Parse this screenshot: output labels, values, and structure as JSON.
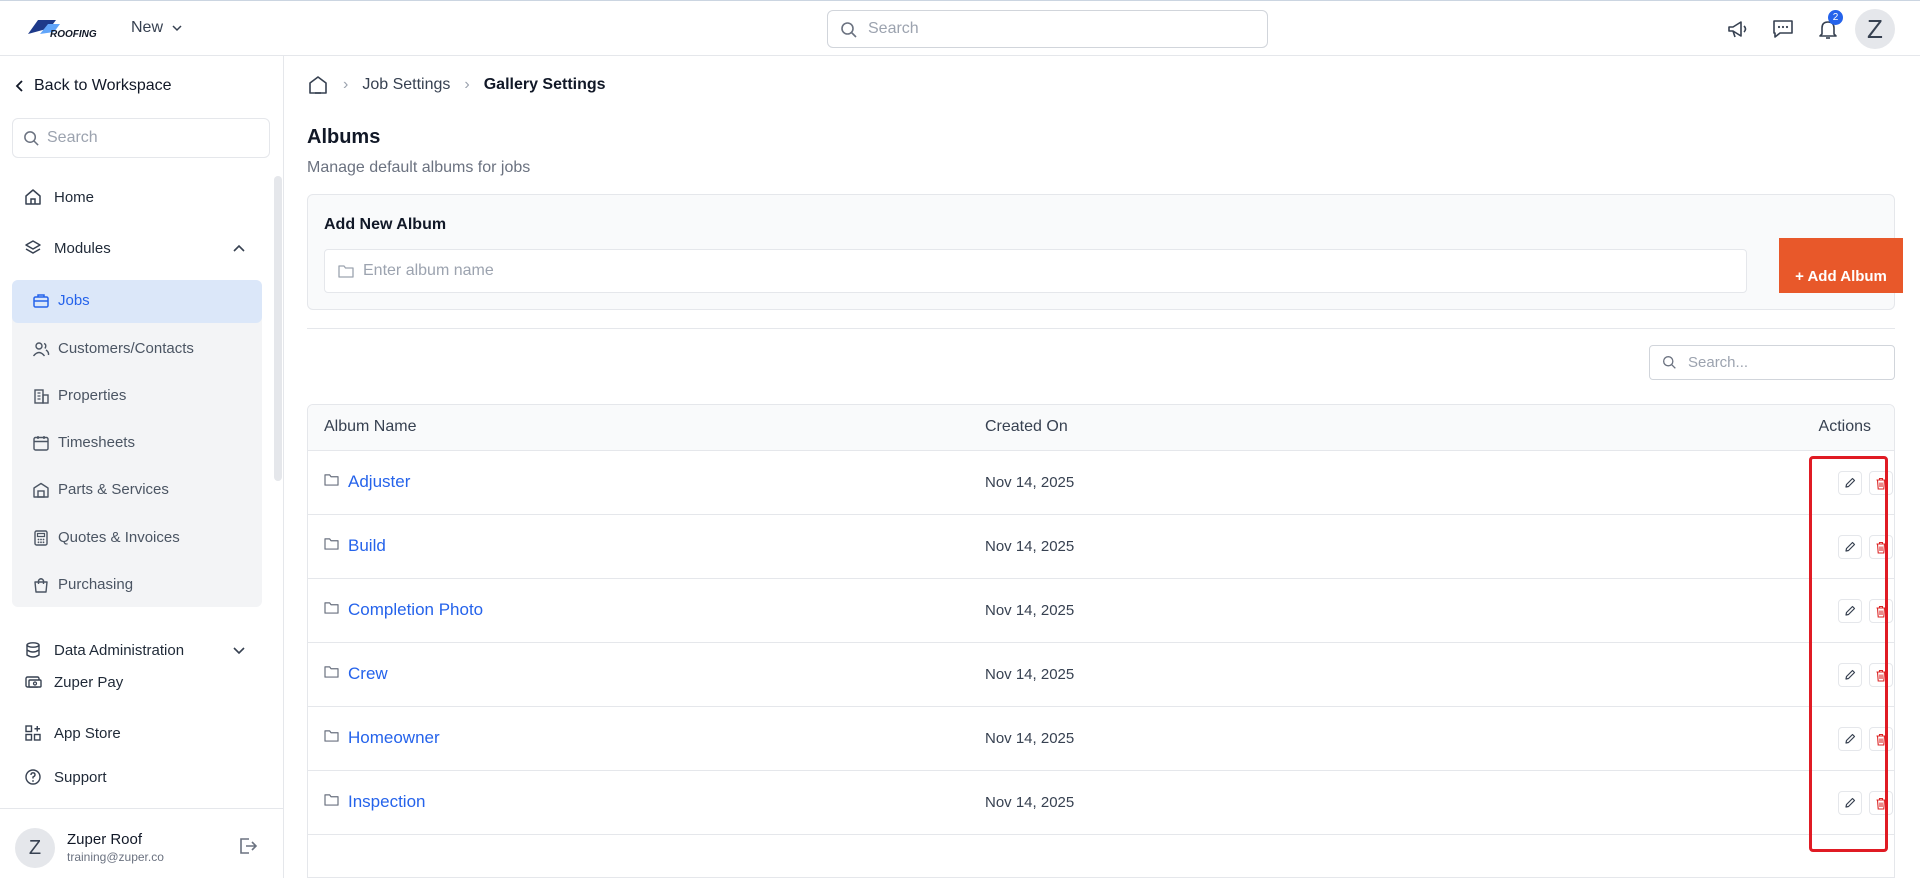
{
  "topbar": {
    "logo_text": "ROOFING",
    "new_label": "New",
    "search_placeholder": "Search",
    "notification_count": "2",
    "avatar_letter": "Z"
  },
  "sidebar": {
    "back_label": "Back to Workspace",
    "search_placeholder": "Search",
    "home_label": "Home",
    "modules_label": "Modules",
    "module_items": [
      {
        "label": "Jobs",
        "icon": "briefcase-icon",
        "active": true
      },
      {
        "label": "Customers/Contacts",
        "icon": "users-icon"
      },
      {
        "label": "Properties",
        "icon": "building-icon"
      },
      {
        "label": "Timesheets",
        "icon": "calendar-icon"
      },
      {
        "label": "Parts & Services",
        "icon": "warehouse-icon"
      },
      {
        "label": "Quotes & Invoices",
        "icon": "calculator-icon"
      },
      {
        "label": "Purchasing",
        "icon": "shopping-bag-icon"
      }
    ],
    "data_admin_label": "Data Administration",
    "zuper_pay_label": "Zuper Pay",
    "app_store_label": "App Store",
    "support_label": "Support",
    "user": {
      "initial": "Z",
      "name": "Zuper Roof",
      "email": "training@zuper.co"
    }
  },
  "main": {
    "breadcrumb": [
      "Job Settings",
      "Gallery Settings"
    ],
    "title": "Albums",
    "subtitle": "Manage default albums for jobs",
    "add_card": {
      "label": "Add New Album",
      "input_placeholder": "Enter album name",
      "button_label": "+ Add Album"
    },
    "table_search_placeholder": "Search...",
    "table": {
      "columns": [
        "Album Name",
        "Created On",
        "Actions"
      ],
      "rows": [
        {
          "name": "Adjuster",
          "created": "Nov 14, 2025"
        },
        {
          "name": "Build",
          "created": "Nov 14, 2025"
        },
        {
          "name": "Completion Photo",
          "created": "Nov 14, 2025"
        },
        {
          "name": "Crew",
          "created": "Nov 14, 2025"
        },
        {
          "name": "Homeowner",
          "created": "Nov 14, 2025"
        },
        {
          "name": "Inspection",
          "created": "Nov 14, 2025"
        }
      ]
    }
  },
  "colors": {
    "accent_blue": "#2563eb",
    "add_button": "#e8582a",
    "highlight_red": "#e01b24",
    "active_item_bg": "#dbe7f9"
  }
}
